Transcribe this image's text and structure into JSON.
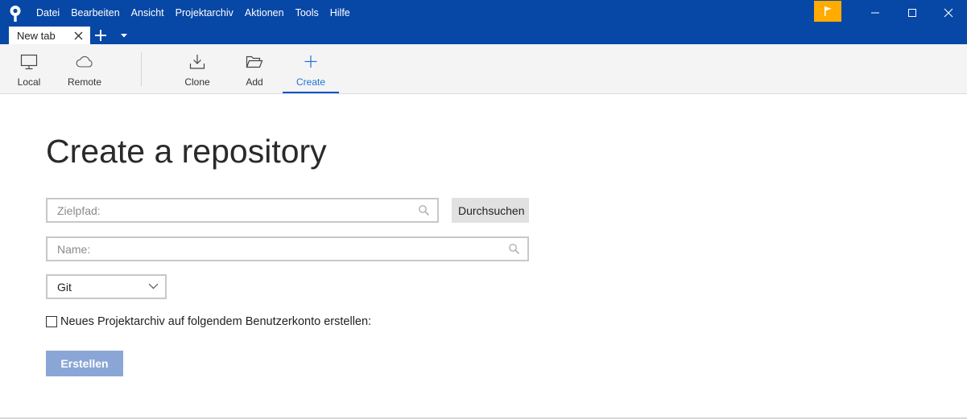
{
  "menu": [
    "Datei",
    "Bearbeiten",
    "Ansicht",
    "Projektarchiv",
    "Aktionen",
    "Tools",
    "Hilfe"
  ],
  "tabs": [
    {
      "label": "New tab"
    }
  ],
  "toolbar": {
    "local": "Local",
    "remote": "Remote",
    "clone": "Clone",
    "add": "Add",
    "create": "Create"
  },
  "main": {
    "title": "Create a repository",
    "path_placeholder": "Zielpfad:",
    "path_value": "",
    "browse_label": "Durchsuchen",
    "name_placeholder": "Name:",
    "name_value": "",
    "vcs_selected": "Git",
    "account_checkbox_label": "Neues Projektarchiv auf folgendem Benutzerkonto erstellen:",
    "account_checkbox_checked": false,
    "create_label": "Erstellen"
  },
  "colors": {
    "titlebar": "#0747a6",
    "flag": "#ffab00",
    "accent": "#0052cc",
    "create_button_disabled": "#8aa6d6"
  },
  "icons": {
    "app": "sourcetree-logo-icon",
    "flag": "flag-icon",
    "local": "monitor-icon",
    "remote": "cloud-icon",
    "clone": "download-icon",
    "add": "folder-open-icon",
    "create": "plus-icon",
    "search": "search-icon"
  }
}
